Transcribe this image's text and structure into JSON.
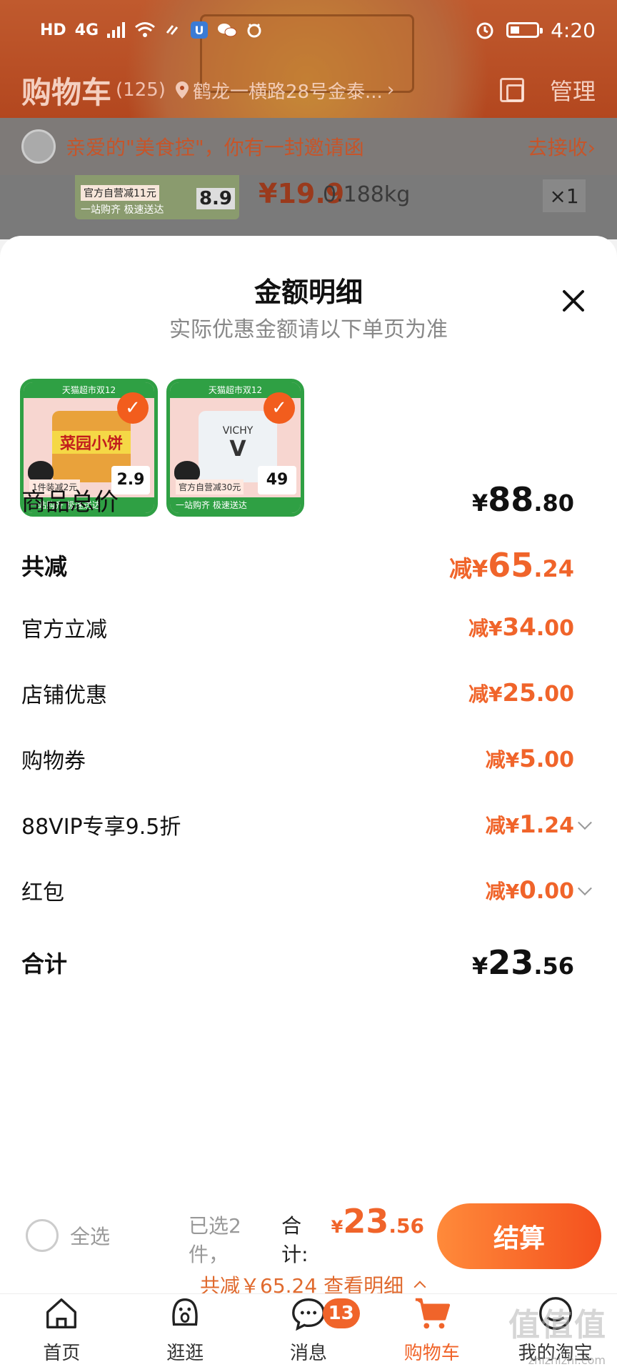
{
  "status_bar": {
    "left_labels": [
      "HD",
      "4G"
    ],
    "time": "4:20"
  },
  "cart_header": {
    "title": "购物车",
    "count": "(125)",
    "location": "鹤龙一横路28号金泰...",
    "manage": "管理"
  },
  "invite": {
    "text": "亲爱的\"美食控\"，你有一封邀请函",
    "accept": "去接收"
  },
  "bg_item": {
    "price": "¥19.9",
    "weight": "0.188kg",
    "qty": "×1",
    "deal": "官方自营减11元",
    "tagline": "一站购齐 极速送达",
    "handprice": "8.9"
  },
  "sheet": {
    "title": "金额明细",
    "subtitle": "实际优惠金额请以下单页为准",
    "thumbs": [
      {
        "banner": "天猫超市双12",
        "name": "菜园小饼",
        "deal": "1件装减2元",
        "tagline": "一站购齐 极速送达",
        "price": "2.9",
        "color": "#e9a23b"
      },
      {
        "banner": "天猫超市双12",
        "name": "VICHY",
        "deal": "官方自营减30元",
        "tagline": "一站购齐 极速送达",
        "price": "49",
        "color": "#eef2f5"
      }
    ],
    "rows": [
      {
        "label": "商品总价",
        "prefix": "¥",
        "int": "88",
        "dec": ".80",
        "style": "total"
      },
      {
        "label": "共减",
        "prefix": "减¥",
        "int": "65",
        "dec": ".24",
        "style": "big-discount"
      },
      {
        "label": "官方立减",
        "prefix": "减¥",
        "int": "34",
        "dec": ".00",
        "style": "discount"
      },
      {
        "label": "店铺优惠",
        "prefix": "减¥",
        "int": "25",
        "dec": ".00",
        "style": "discount"
      },
      {
        "label": "购物券",
        "prefix": "减¥",
        "int": "5",
        "dec": ".00",
        "style": "discount"
      },
      {
        "label": "88VIP专享9.5折",
        "prefix": "减¥",
        "int": "1",
        "dec": ".24",
        "style": "discount",
        "expandable": true
      },
      {
        "label": "红包",
        "prefix": "减¥",
        "int": "0",
        "dec": ".00",
        "style": "discount",
        "expandable": true
      },
      {
        "label": "合计",
        "prefix": "¥",
        "int": "23",
        "dec": ".56",
        "style": "total"
      }
    ]
  },
  "action_bar": {
    "select_all": "全选",
    "selected": "已选2件，",
    "total_label": "合计:",
    "total_yen": "¥",
    "total_int": "23",
    "total_dec": ".56",
    "saving": "共减￥65.24 查看明细",
    "checkout": "结算"
  },
  "tabbar": {
    "items": [
      {
        "label": "首页",
        "icon": "home-icon"
      },
      {
        "label": "逛逛",
        "icon": "discover-icon"
      },
      {
        "label": "消息",
        "icon": "message-icon",
        "badge": "13"
      },
      {
        "label": "购物车",
        "icon": "cart-icon",
        "active": true
      },
      {
        "label": "我的淘宝",
        "icon": "profile-icon"
      }
    ]
  },
  "watermark": {
    "main": "值值值",
    "sub": "zhizhizhi.com"
  },
  "colors": {
    "accent": "#f0642a",
    "green": "#2fa044"
  }
}
